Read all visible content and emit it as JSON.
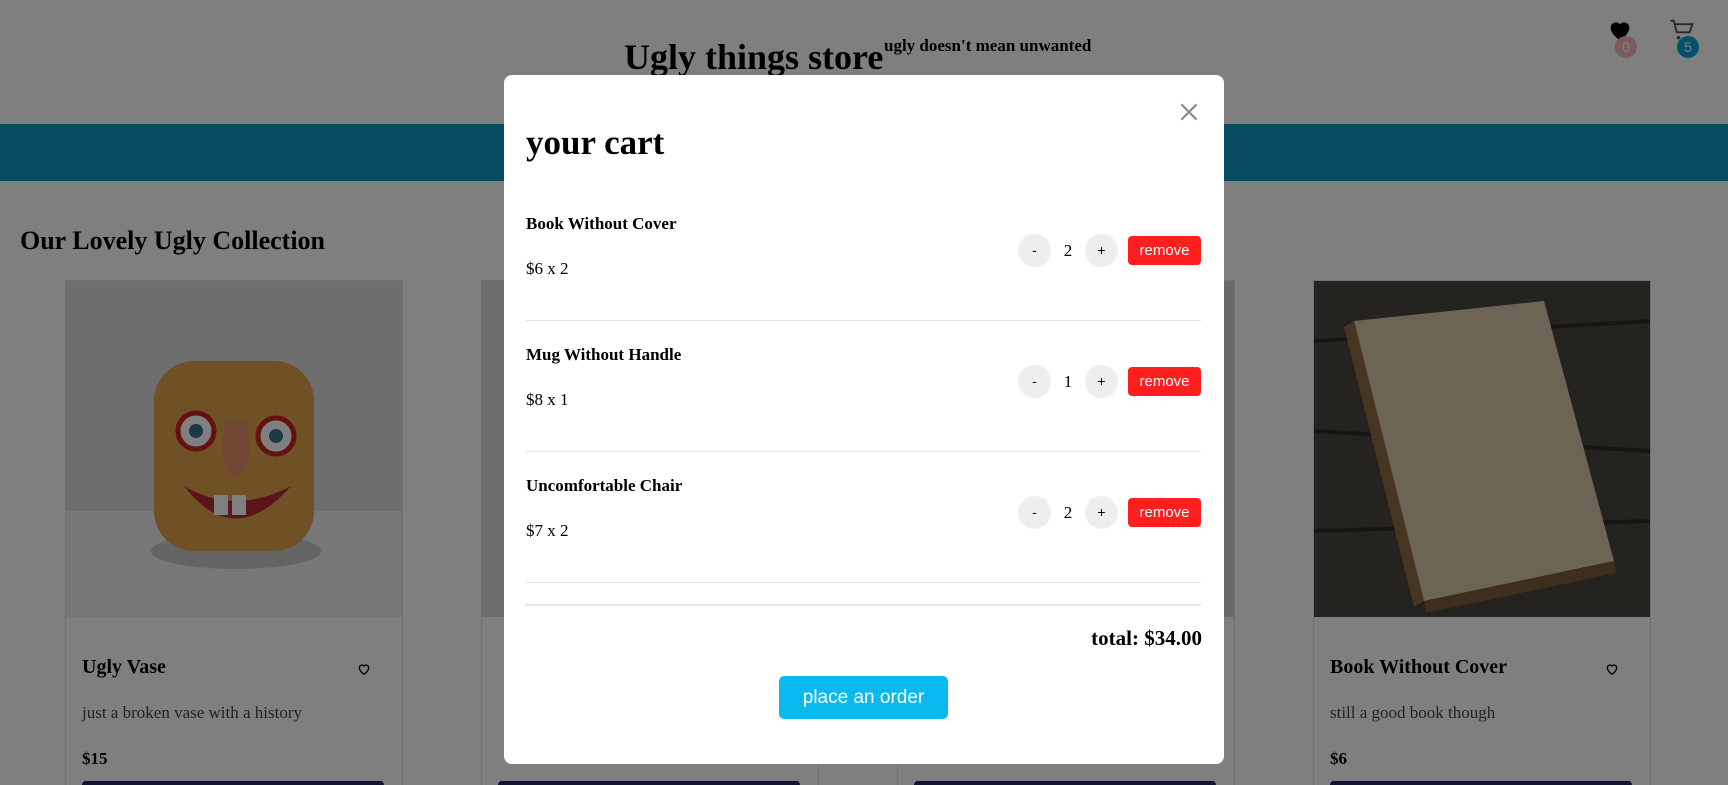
{
  "header": {
    "store_title": "Ugly things store",
    "tagline": "ugly doesn't mean unwanted",
    "wishlist_count": "0",
    "cart_count": "5"
  },
  "main": {
    "section_title": "Our Lovely Ugly Collection",
    "cards": [
      {
        "name": "Ugly Vase",
        "desc": "just a broken vase with a history",
        "price": "$15"
      },
      {
        "name": "Book Without Cover",
        "desc": "still a good book though",
        "price": "$6"
      }
    ]
  },
  "cart_modal": {
    "title": "your cart",
    "items": [
      {
        "name": "Book Without Cover",
        "price_line": "$6 x 2",
        "quantity": "2"
      },
      {
        "name": "Mug Without Handle",
        "price_line": "$8 x 1",
        "quantity": "1"
      },
      {
        "name": "Uncomfortable Chair",
        "price_line": "$7 x 2",
        "quantity": "2"
      }
    ],
    "minus_label": "-",
    "plus_label": "+",
    "remove_label": "remove",
    "total_label": "total: $34.00",
    "order_label": "place an order"
  }
}
